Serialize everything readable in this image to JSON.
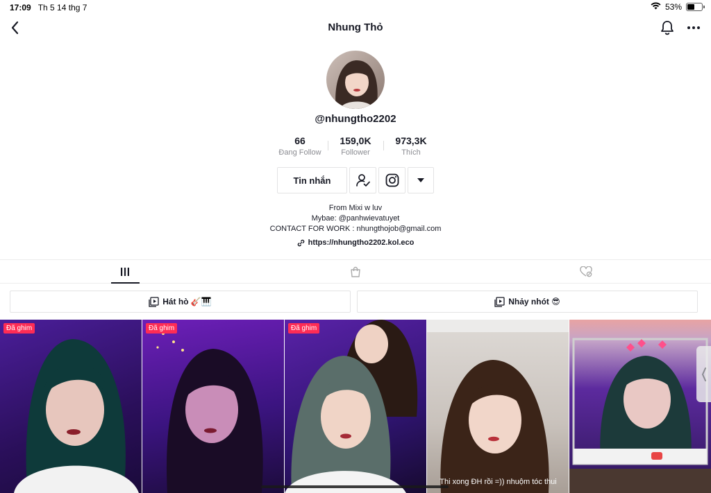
{
  "status_bar": {
    "time": "17:09",
    "date": "Th 5 14 thg 7",
    "battery_percent": "53%",
    "battery_level": 0.53
  },
  "nav": {
    "title": "Nhung Thỏ",
    "icons": {
      "back": "chevron-left-icon",
      "bell": "bell-icon",
      "more": "more-dots-icon"
    }
  },
  "profile": {
    "username": "@nhungtho2202",
    "stats": [
      {
        "value": "66",
        "label": "Đang Follow"
      },
      {
        "value": "159,0K",
        "label": "Follower"
      },
      {
        "value": "973,3K",
        "label": "Thích"
      }
    ],
    "message_label": "Tin nhắn",
    "bio_lines": [
      "From Mixi w luv",
      "Mybae: @panhwievatuyet",
      "CONTACT FOR WORK : nhungthojob@gmail.com"
    ],
    "link": "https://nhungtho2202.kol.eco"
  },
  "tabs": [
    {
      "icon": "video-grid-icon",
      "active": true
    },
    {
      "icon": "shopping-bag-icon",
      "active": false
    },
    {
      "icon": "liked-heart-icon",
      "active": false
    }
  ],
  "playlists": [
    {
      "label": "Hát hò 🎸🎹"
    },
    {
      "label": "Nhảy nhót 😎"
    }
  ],
  "videos": [
    {
      "pin_label": "Đã ghim",
      "caption": ""
    },
    {
      "pin_label": "Đã ghim",
      "caption": ""
    },
    {
      "pin_label": "Đã ghim",
      "caption": ""
    },
    {
      "pin_label": "",
      "caption": "Thi xong ĐH rồi =)) nhuộm tóc thui"
    },
    {
      "pin_label": "",
      "caption": ""
    }
  ],
  "colors": {
    "accent": "#fe2c55",
    "text": "#161823",
    "muted": "#8a8b91",
    "border": "#e3e3e4"
  }
}
